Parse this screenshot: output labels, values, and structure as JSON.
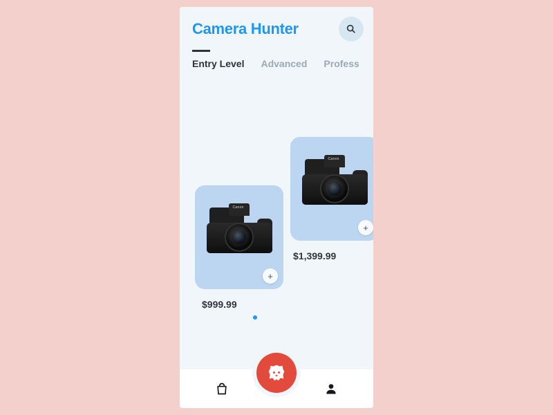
{
  "header": {
    "title": "Camera Hunter"
  },
  "tabs": [
    {
      "label": "Entry Level",
      "active": true
    },
    {
      "label": "Advanced",
      "active": false
    },
    {
      "label": "Profess",
      "active": false
    }
  ],
  "products": [
    {
      "brand": "Canon",
      "price": "$999.99"
    },
    {
      "brand": "Canon",
      "price": "$1,399.99"
    }
  ],
  "icons": {
    "plus": "+"
  }
}
